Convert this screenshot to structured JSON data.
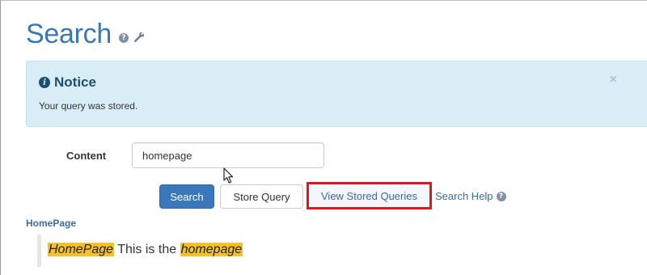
{
  "header": {
    "title": "Search",
    "help_icon": "help-circle-icon",
    "settings_icon": "wrench-icon"
  },
  "notice": {
    "icon": "info-icon",
    "title": "Notice",
    "message": "Your query was stored.",
    "close_label": "×"
  },
  "form": {
    "content_label": "Content",
    "content_value": "homepage",
    "buttons": {
      "search": "Search",
      "store": "Store Query",
      "view_stored": "View Stored Queries"
    },
    "help_link": "Search Help"
  },
  "results": [
    {
      "title": "HomePage",
      "snippet": {
        "highlight_1": "HomePage",
        "middle_text": " This is the ",
        "highlight_2": "homepage"
      }
    }
  ],
  "colors": {
    "accent": "#3a78b4",
    "notice_bg": "#d9edf7",
    "highlight": "#f6c12a",
    "annotation_box": "#e8121d"
  }
}
